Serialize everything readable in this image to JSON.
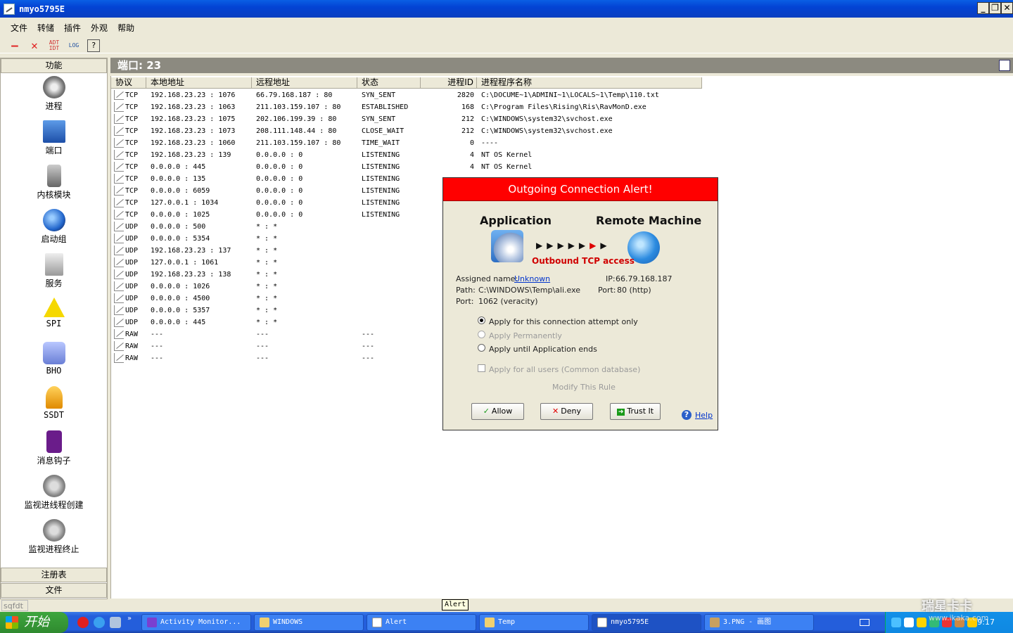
{
  "window": {
    "title": "nmyo5795E"
  },
  "menu": [
    "文件",
    "转储",
    "插件",
    "外观",
    "帮助"
  ],
  "toolbar": {
    "adt": "ADT\nIDT",
    "log": "LOG",
    "help": "?"
  },
  "left_panel": {
    "header": "功能",
    "items": [
      "进程",
      "端口",
      "内核模块",
      "启动组",
      "服务",
      "SPI",
      "BHO",
      "SSDT",
      "消息钩子",
      "监视进线程创建",
      "监视进程终止"
    ],
    "registry_header": "注册表",
    "file_header": "文件"
  },
  "port_header": "端口: 23",
  "table": {
    "columns": [
      "协议",
      "本地地址",
      "远程地址",
      "状态",
      "进程ID",
      "进程程序名称"
    ],
    "rows": [
      [
        "TCP",
        "192.168.23.23 : 1076",
        "66.79.168.187 : 80",
        "SYN_SENT",
        "2820",
        "C:\\DOCUME~1\\ADMINI~1\\LOCALS~1\\Temp\\110.txt"
      ],
      [
        "TCP",
        "192.168.23.23 : 1063",
        "211.103.159.107 : 80",
        "ESTABLISHED",
        "168",
        "C:\\Program Files\\Rising\\Ris\\RavMonD.exe"
      ],
      [
        "TCP",
        "192.168.23.23 : 1075",
        "202.106.199.39 : 80",
        "SYN_SENT",
        "212",
        "C:\\WINDOWS\\system32\\svchost.exe"
      ],
      [
        "TCP",
        "192.168.23.23 : 1073",
        "208.111.148.44 : 80",
        "CLOSE_WAIT",
        "212",
        "C:\\WINDOWS\\system32\\svchost.exe"
      ],
      [
        "TCP",
        "192.168.23.23 : 1060",
        "211.103.159.107 : 80",
        "TIME_WAIT",
        "0",
        "----"
      ],
      [
        "TCP",
        "192.168.23.23 : 139",
        "0.0.0.0 : 0",
        "LISTENING",
        "4",
        "NT OS Kernel"
      ],
      [
        "TCP",
        "0.0.0.0 : 445",
        "0.0.0.0 : 0",
        "LISTENING",
        "4",
        "NT OS Kernel"
      ],
      [
        "TCP",
        "0.0.0.0 : 135",
        "0.0.0.0 : 0",
        "LISTENING",
        "",
        ""
      ],
      [
        "TCP",
        "0.0.0.0 : 6059",
        "0.0.0.0 : 0",
        "LISTENING",
        "",
        ""
      ],
      [
        "TCP",
        "127.0.0.1 : 1034",
        "0.0.0.0 : 0",
        "LISTENING",
        "",
        ""
      ],
      [
        "TCP",
        "0.0.0.0 : 1025",
        "0.0.0.0 : 0",
        "LISTENING",
        "",
        ""
      ],
      [
        "UDP",
        "0.0.0.0 : 500",
        "* : *",
        "",
        "",
        ""
      ],
      [
        "UDP",
        "0.0.0.0 : 5354",
        "* : *",
        "",
        "",
        ""
      ],
      [
        "UDP",
        "192.168.23.23 : 137",
        "* : *",
        "",
        "",
        ""
      ],
      [
        "UDP",
        "127.0.0.1 : 1061",
        "* : *",
        "",
        "",
        ""
      ],
      [
        "UDP",
        "192.168.23.23 : 138",
        "* : *",
        "",
        "",
        ""
      ],
      [
        "UDP",
        "0.0.0.0 : 1026",
        "* : *",
        "",
        "",
        ""
      ],
      [
        "UDP",
        "0.0.0.0 : 4500",
        "* : *",
        "",
        "",
        ""
      ],
      [
        "UDP",
        "0.0.0.0 : 5357",
        "* : *",
        "",
        "",
        ""
      ],
      [
        "UDP",
        "0.0.0.0 : 445",
        "* : *",
        "",
        "",
        ""
      ],
      [
        "RAW",
        "---",
        "---",
        "---",
        "",
        ""
      ],
      [
        "RAW",
        "---",
        "---",
        "---",
        "",
        ""
      ],
      [
        "RAW",
        "---",
        "---",
        "---",
        "",
        ""
      ]
    ]
  },
  "alert": {
    "title": "Outgoing Connection Alert!",
    "application_label": "Application",
    "remote_label": "Remote Machine",
    "access_text": "Outbound TCP access",
    "assigned_name_label": "Assigned name:",
    "assigned_name_value": "Unknown",
    "path_label": "Path:",
    "path_value": "C:\\WINDOWS\\Temp\\ali.exe",
    "port_label": "Port:",
    "port_value": "1062 (veracity)",
    "ip_label": "IP:",
    "ip_value": "66.79.168.187",
    "remote_port_label": "Port:",
    "remote_port_value": "80 (http)",
    "option_once": "Apply for this connection attempt only",
    "option_permanent": "Apply Permanently",
    "option_until_end": "Apply until Application ends",
    "option_all_users": "Apply for all users (Common database)",
    "modify_rule": "Modify This Rule",
    "allow_button": "Allow",
    "deny_button": "Deny",
    "trust_button": "Trust It",
    "help_link": "Help",
    "accent_color": "#ff0000"
  },
  "status_bar": {
    "text": "sqfdt",
    "tooltip": "Alert"
  },
  "taskbar": {
    "start_label": "开始",
    "tasks": [
      "Activity Monitor...",
      "WINDOWS",
      "Alert",
      "Temp",
      "nmyo5795E",
      "3.PNG - 画图"
    ],
    "clock": "9:17"
  },
  "watermark": {
    "brand": "瑞星卡卡",
    "url": "www.ikaka.com"
  }
}
